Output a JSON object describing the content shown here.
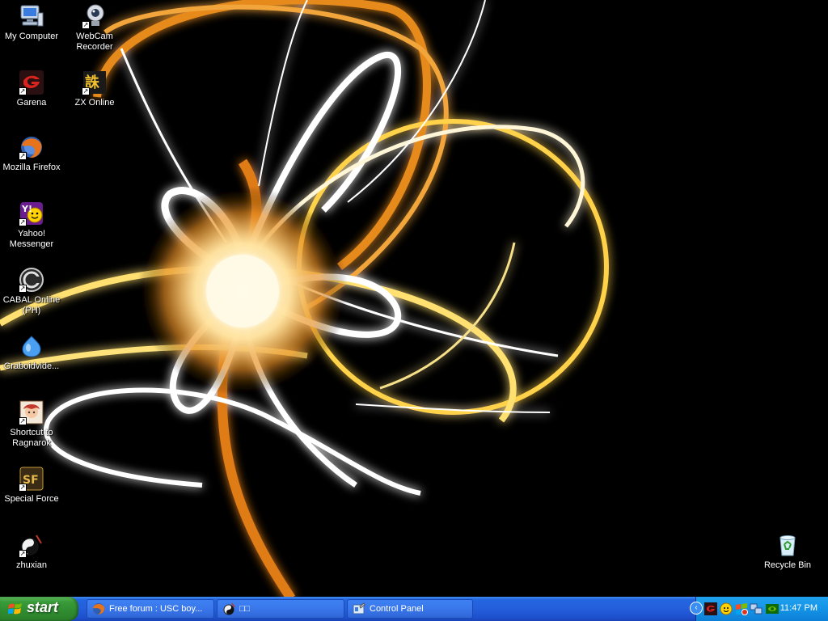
{
  "desktop": {
    "icons": [
      {
        "label": "My Computer",
        "icon": "my-computer-icon",
        "shortcut": false
      },
      {
        "label": "WebCam Recorder",
        "icon": "webcam-icon",
        "shortcut": true
      },
      {
        "label": "Garena",
        "icon": "garena-icon",
        "shortcut": true
      },
      {
        "label": "ZX Online",
        "icon": "zx-online-icon",
        "shortcut": true
      },
      {
        "label": "Mozilla Firefox",
        "icon": "firefox-icon",
        "shortcut": true
      },
      {
        "label": "Yahoo! Messenger",
        "icon": "yahoo-messenger-icon",
        "shortcut": true
      },
      {
        "label": "CABAL Online (PH)",
        "icon": "cabal-online-icon",
        "shortcut": true
      },
      {
        "label": "Graboidvide...",
        "icon": "graboid-icon",
        "shortcut": false
      },
      {
        "label": "Shortcut to Ragnarok",
        "icon": "ragnarok-icon",
        "shortcut": true
      },
      {
        "label": "Special Force",
        "icon": "special-force-icon",
        "shortcut": true
      },
      {
        "label": "zhuxian",
        "icon": "zhuxian-icon",
        "shortcut": true
      },
      {
        "label": "Recycle Bin",
        "icon": "recycle-bin-icon",
        "shortcut": false
      }
    ]
  },
  "taskbar": {
    "start_label": "start",
    "tasks": [
      {
        "label": "Free forum : USC boy...",
        "icon": "firefox-icon"
      },
      {
        "label": "□□",
        "icon": "game-window-icon"
      },
      {
        "label": "Control Panel",
        "icon": "control-panel-icon"
      }
    ],
    "tray": {
      "icons": [
        "expand-tray-icon",
        "garena-tray-icon",
        "yahoo-tray-icon",
        "security-tray-icon",
        "network-tray-icon",
        "nvidia-tray-icon"
      ],
      "clock": "11:47 PM"
    }
  },
  "colors": {
    "taskbar_blue": "#245edb",
    "start_green": "#3a9c3a",
    "tray_blue": "#1494e6"
  }
}
